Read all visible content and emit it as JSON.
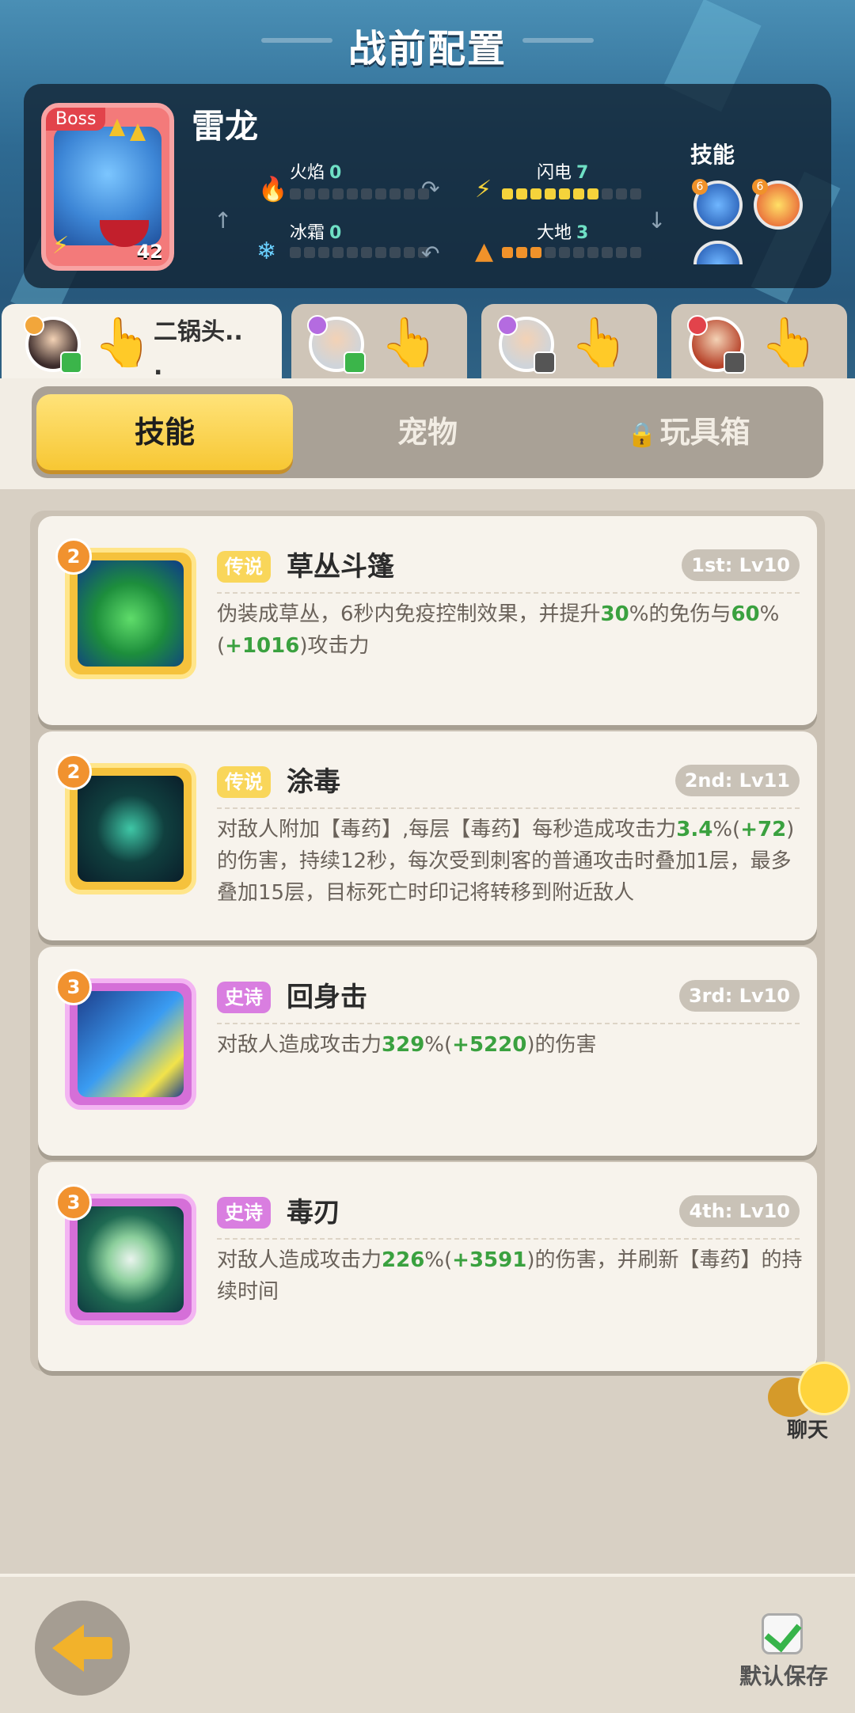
{
  "header": {
    "title": "战前配置"
  },
  "boss": {
    "tag": "Boss",
    "name": "雷龙",
    "level": "42",
    "stats": {
      "fire": {
        "label": "火焰",
        "value": "0"
      },
      "thunder": {
        "label": "闪电",
        "value": "7"
      },
      "ice": {
        "label": "冰霜",
        "value": "0"
      },
      "earth": {
        "label": "大地",
        "value": "3"
      }
    },
    "skills_label": "技能",
    "skill_orb_levels": [
      "6",
      "6"
    ]
  },
  "players": [
    {
      "name": "二锅头..\n.",
      "active": true
    },
    {
      "name": "",
      "active": false
    },
    {
      "name": "",
      "active": false
    },
    {
      "name": "",
      "active": false
    }
  ],
  "tabs": [
    {
      "label": "技能",
      "active": true
    },
    {
      "label": "宠物",
      "active": false
    },
    {
      "label": "玩具箱",
      "active": false,
      "locked": true
    }
  ],
  "skills": [
    {
      "badge": "2",
      "rarity": "传说",
      "name": "草丛斗篷",
      "level": "1st: Lv10",
      "desc_parts": [
        "伪装成草丛，6秒内免疫控制效果，并提升",
        "30",
        "%的免伤与",
        "60",
        "%(",
        "+1016",
        ")攻击力"
      ]
    },
    {
      "badge": "2",
      "rarity": "传说",
      "name": "涂毒",
      "level": "2nd: Lv11",
      "desc_parts": [
        "对敌人附加【毒药】,每层【毒药】每秒造成攻击力",
        "3.4",
        "%(",
        "+72",
        ")的伤害，持续12秒，每次受到刺客的普通攻击时叠加1层，最多叠加15层，目标死亡时印记将转移到附近敌人"
      ]
    },
    {
      "badge": "3",
      "rarity": "史诗",
      "name": "回身击",
      "level": "3rd: Lv10",
      "desc_parts": [
        "对敌人造成攻击力",
        "329",
        "%(",
        "+5220",
        ")的伤害"
      ]
    },
    {
      "badge": "3",
      "rarity": "史诗",
      "name": "毒刃",
      "level": "4th: Lv10",
      "desc_parts": [
        "对敌人造成攻击力",
        "226",
        "%(",
        "+3591",
        ")的伤害，并刷新【毒药】的持续时间"
      ]
    }
  ],
  "chat": {
    "label": "聊天"
  },
  "footer": {
    "save_label": "默认保存"
  },
  "colors": {
    "accent": "#f7c733",
    "green_value": "#3aa13f",
    "legend": "#f9d65a",
    "epic": "#d97ee0"
  }
}
